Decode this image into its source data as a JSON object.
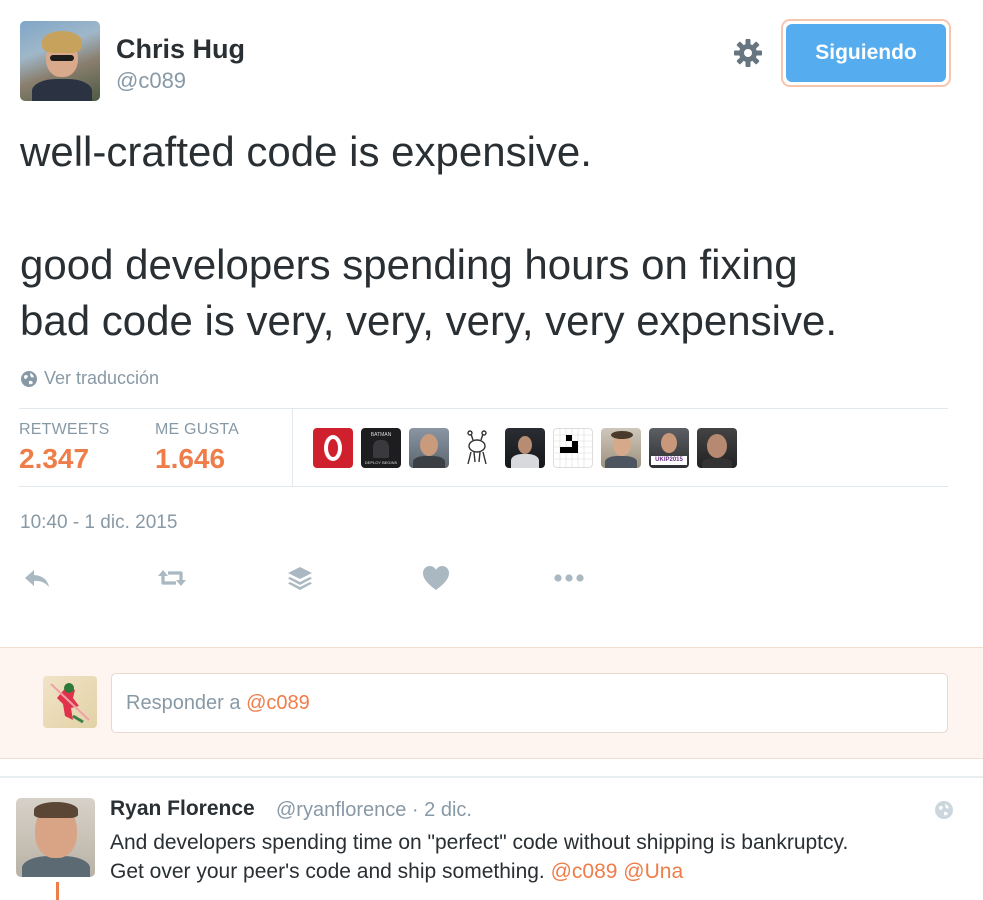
{
  "tweet": {
    "author_name": "Chris Hug",
    "author_handle": "@c089",
    "follow_label": "Siguiendo",
    "text_line1": "well-crafted code is expensive.",
    "text_line2": "good developers spending hours on fixing",
    "text_line3": "bad code is very, very, very, very expensive.",
    "translate_label": "Ver traducción",
    "stats": {
      "retweets_label": "RETWEETS",
      "retweets_value": "2.347",
      "likes_label": "ME GUSTA",
      "likes_value": "1.646"
    },
    "timestamp": "10:40 - 1 dic. 2015",
    "actions": [
      "reply-icon",
      "retweet-icon",
      "buffer-icon",
      "heart-icon",
      "more-icon"
    ],
    "liker_avatar_text": {
      "batman_top": "BATMAN",
      "batman_bottom": "DEPLOY BEGINS",
      "ukip": "UKIP2015"
    }
  },
  "reply_box": {
    "prefix": "Responder a ",
    "mention": "@c089"
  },
  "reply": {
    "author_name": "Ryan Florence",
    "meta": "@ryanflorence · 2 dic.",
    "line1": "And developers spending time on \"perfect\" code without shipping is bankruptcy.",
    "line2_text": "Get over your peer's code and ship something. ",
    "mention1": "@c089",
    "mention2": "@Una"
  },
  "colors": {
    "accent_orange": "#ef7d4a",
    "follow_blue": "#55acee",
    "muted": "#8899a6",
    "text": "#292f33"
  }
}
